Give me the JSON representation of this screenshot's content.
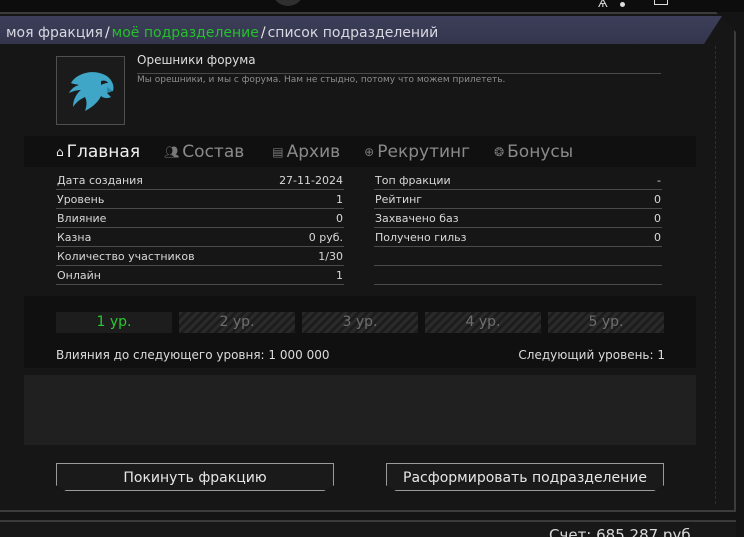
{
  "breadcrumb": {
    "items": [
      {
        "label": "моя фракция"
      },
      {
        "label": "моё подразделение"
      },
      {
        "label": "список подразделений"
      }
    ],
    "separator": "/",
    "active_color": "#23c12a"
  },
  "faction": {
    "logo_icon": "eagle-head-icon",
    "name": "Орешники форума",
    "description": "Мы орешники, и мы с форума. Нам не стыдно, потому что можем прилететь."
  },
  "tabs": [
    {
      "label": "Главная",
      "icon": "home-icon",
      "active": true
    },
    {
      "label": "Состав",
      "icon": "users-icon",
      "active": false
    },
    {
      "label": "Архив",
      "icon": "archive-icon",
      "active": false
    },
    {
      "label": "Рекрутинг",
      "icon": "recruit-icon",
      "active": false
    },
    {
      "label": "Бонусы",
      "icon": "bonus-icon",
      "active": false
    }
  ],
  "stats_left": [
    {
      "label": "Дата создания",
      "value": "27-11-2024"
    },
    {
      "label": "Уровень",
      "value": "1"
    },
    {
      "label": "Влияние",
      "value": "0"
    },
    {
      "label": "Казна",
      "value": "0 руб."
    },
    {
      "label": "Количество участников",
      "value": "1/30"
    },
    {
      "label": "Онлайн",
      "value": "1"
    }
  ],
  "stats_right": [
    {
      "label": "Топ фракции",
      "value": "-"
    },
    {
      "label": "Рейтинг",
      "value": "0"
    },
    {
      "label": "Захвачено баз",
      "value": "0"
    },
    {
      "label": "Получено гильз",
      "value": "0"
    },
    {
      "label": "",
      "value": ""
    },
    {
      "label": "",
      "value": ""
    }
  ],
  "levels": {
    "cells": [
      "1 ур.",
      "2 ур.",
      "3 ур.",
      "4 ур.",
      "5 ур."
    ],
    "current": 1,
    "influence_to_next": "Влияния до следующего уровня: 1 000 000",
    "next_level": "Следующий уровень: 1"
  },
  "actions": {
    "leave": "Покинуть фракцию",
    "disband": "Расформировать подразделение"
  },
  "footer": {
    "balance": "Счет: 685 287 руб."
  },
  "colors": {
    "accent_green": "#23c12a",
    "logo_blue": "#3fa6c8",
    "breadcrumb_bg": "#3a3c55"
  }
}
